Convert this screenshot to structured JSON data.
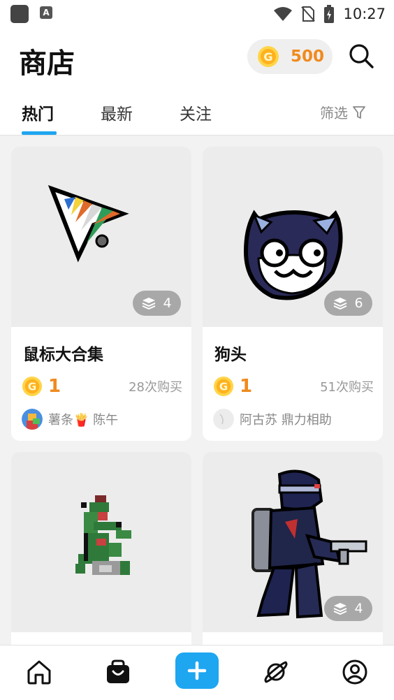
{
  "status_bar": {
    "time": "10:27"
  },
  "header": {
    "title": "商店",
    "coins": "500",
    "coin_symbol": "G",
    "accent_color": "#1ea6f0",
    "coin_color": "#f08a1e"
  },
  "tabs": [
    {
      "label": "热门",
      "active": true
    },
    {
      "label": "最新",
      "active": false
    },
    {
      "label": "关注",
      "active": false
    }
  ],
  "filter_label": "筛选",
  "products": [
    {
      "title": "鼠标大合集",
      "layers": "4",
      "price": "1",
      "sales": "28次购买",
      "author": "薯条🍟 陈午",
      "image": "cursor-arrow-art"
    },
    {
      "title": "狗头",
      "layers": "6",
      "price": "1",
      "sales": "51次购买",
      "author": "阿古苏 鼎力相助",
      "image": "cat-face-art"
    },
    {
      "title": "",
      "layers": "",
      "price": "",
      "sales": "",
      "author": "",
      "image": "pixel-lizard-art"
    },
    {
      "title": "",
      "layers": "4",
      "price": "",
      "sales": "",
      "author": "",
      "image": "pixel-soldier-art"
    }
  ],
  "bottom_nav": [
    {
      "name": "home",
      "icon": "home-icon"
    },
    {
      "name": "shop",
      "icon": "shop-bag-icon"
    },
    {
      "name": "create",
      "icon": "plus-icon"
    },
    {
      "name": "explore",
      "icon": "planet-icon"
    },
    {
      "name": "profile",
      "icon": "user-icon"
    }
  ]
}
